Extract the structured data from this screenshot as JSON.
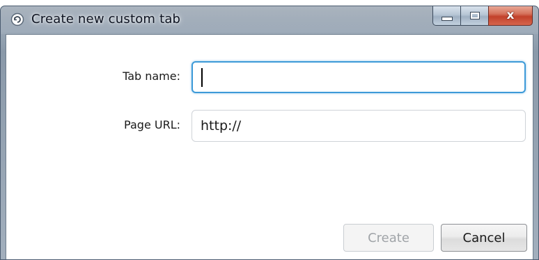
{
  "window": {
    "title": "Create new custom tab",
    "close_glyph": "x"
  },
  "form": {
    "tab_name": {
      "label": "Tab name:",
      "value": ""
    },
    "page_url": {
      "label": "Page URL:",
      "value": "http://"
    }
  },
  "buttons": {
    "create": "Create",
    "cancel": "Cancel"
  },
  "colors": {
    "focus_border": "#3d9ad8",
    "close_button": "#c2412b"
  }
}
